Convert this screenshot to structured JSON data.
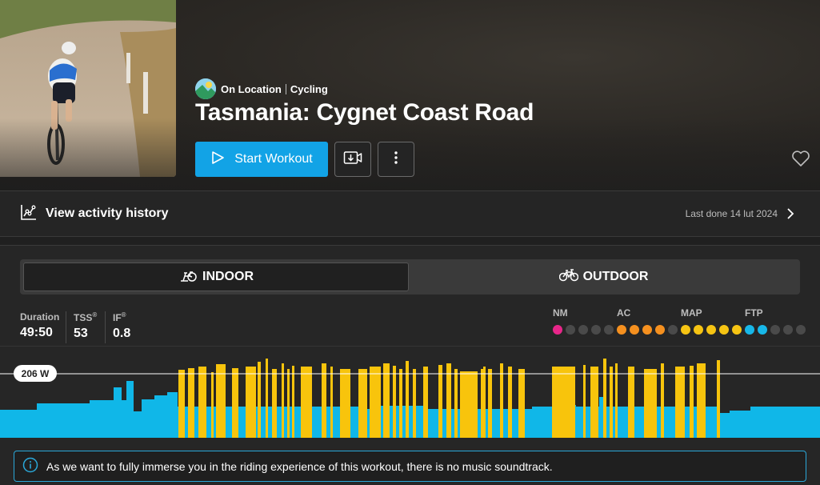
{
  "header": {
    "brand": "On Location",
    "category": "Cycling",
    "title": "Tasmania: Cygnet Coast Road",
    "start_label": "Start Workout"
  },
  "history": {
    "label": "View activity history",
    "last_done": "Last done 14 lut 2024"
  },
  "toggle": {
    "indoor": "INDOOR",
    "outdoor": "OUTDOOR",
    "selected": "INDOOR"
  },
  "stats": {
    "duration_label": "Duration",
    "duration_value": "49:50",
    "tss_label": "TSS",
    "tss_value": "53",
    "if_label": "IF",
    "if_value": "0.8",
    "registered": "®"
  },
  "ratings": [
    {
      "label": "NM",
      "level": 1,
      "color": "#e8268a"
    },
    {
      "label": "AC",
      "level": 4,
      "color": "#f5901f"
    },
    {
      "label": "MAP",
      "level": 5,
      "color": "#f6c413"
    },
    {
      "label": "FTP",
      "level": 2,
      "color": "#17b7e8"
    }
  ],
  "chart_data": {
    "type": "bar",
    "ftp_label": "206 W",
    "colors": {
      "base": "#10b7e8",
      "interval": "#f8c40c",
      "ftp_line": "#ffffff"
    }
  },
  "notice": {
    "text": "As we want to fully immerse you in the riding experience of this workout, there is no music soundtrack."
  },
  "icons": {
    "start": "play-icon",
    "download": "download-video-icon",
    "more": "more-vertical-icon",
    "favorite": "heart-icon",
    "history": "activity-chart-icon",
    "chevron": "chevron-right-icon",
    "indoor": "indoor-bike-icon",
    "outdoor": "bicycle-icon",
    "info": "info-icon"
  }
}
